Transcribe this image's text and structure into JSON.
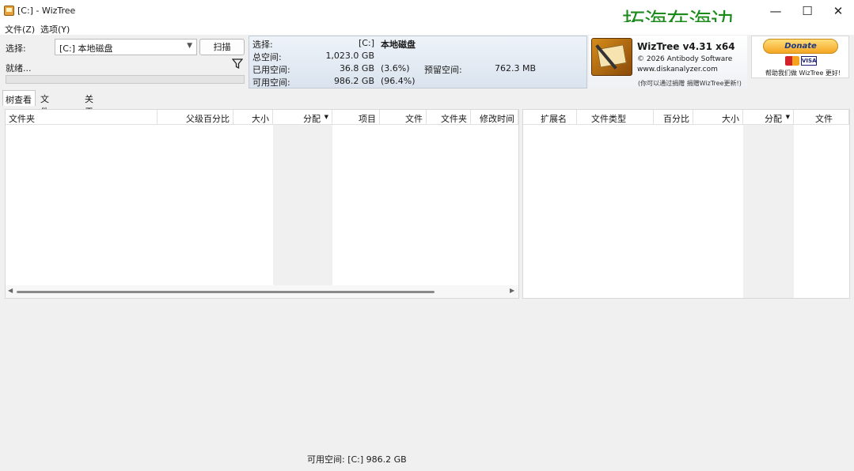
{
  "window": {
    "title": "[C:] - WizTree",
    "watermark": "拓海在海边",
    "minimize": "—",
    "maximize": "☐",
    "close": "✕"
  },
  "menu": [
    "文件(Z)",
    "选项(Y)"
  ],
  "controls": {
    "select_label": "选择:",
    "drive_value": "[C:] 本地磁盘",
    "scan_label": "扫描",
    "status": "就绪..."
  },
  "info": {
    "select_label": "选择:",
    "drive_code": "[C:]",
    "drive_name": "本地磁盘",
    "total_label": "总空间:",
    "total_value": "1,023.0 GB",
    "used_label": "已用空间:",
    "used_value": "36.8 GB",
    "used_pct": "(3.6%)",
    "free_label": "可用空间:",
    "free_value": "986.2 GB",
    "free_pct": "(96.4%)",
    "reserved_label": "预留空间:",
    "reserved_value": "762.3 MB"
  },
  "about": {
    "app_name": "WizTree v4.31 x64",
    "copyright": "© 2026 Antibody Software",
    "website": "www.diskanalyzer.com",
    "support_note": "(你可以通过捐赠 捐赠WizTree更新!)"
  },
  "donate": {
    "button": "Donate",
    "visa": "VISA",
    "note": "帮助我们做 WizTree 更好!"
  },
  "tabs": [
    "树查看",
    "文件查看",
    "关于"
  ],
  "tree_columns": [
    "文件夹",
    "父级百分比",
    "大小",
    "分配",
    "项目",
    "文件",
    "文件夹",
    "修改时间"
  ],
  "ext_columns": [
    "扩展名",
    "文件类型",
    "百分比",
    "大小",
    "分配",
    "文件"
  ],
  "statusbar": {
    "free_space": "可用空间: [C:] 986.2 GB"
  }
}
